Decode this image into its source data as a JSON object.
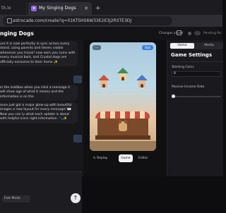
{
  "browser": {
    "prev_tab_label": "th.io",
    "tab_title": "My Singing Dogs",
    "tab_close_icon": "close-icon",
    "new_tab_label": "+",
    "url": "astrocade.com/create?q=01KTSHS6W33E2E3J2RSTE3DJ"
  },
  "header": {
    "title": "nging Dogs",
    "changes_label": "Changes saved",
    "pending_label": "Pending Re"
  },
  "chat": {
    "messages": [
      "ure it is now perfectly in sync across every stand, using parents and timers visible whenever you travel! now earn you coins with every musical bark, and Crystal dogs are officially exclusive to their home ✨",
      "in the mailbox when you click a message it will show age of what it means and the information is on the",
      "ance just got a major glow-up with beautiful images a new layout for every message! 💌 Now you can ly what each update is about with helpful icons right information. 🐾✨"
    ],
    "model_label": "Fast Mode",
    "send_label": "↑"
  },
  "preview": {
    "left_chip": "···",
    "right_chip": "Stat",
    "replay_label": "Replay",
    "game_tab_label": "Game",
    "editor_label": "Editor"
  },
  "settings": {
    "tabs": [
      "Home",
      "Media"
    ],
    "title": "Game Settings",
    "fields": [
      {
        "label": "Starting Coins",
        "value": "0"
      },
      {
        "label": "Passive Income Rate",
        "value": ""
      }
    ],
    "passive_income_level": 0
  }
}
